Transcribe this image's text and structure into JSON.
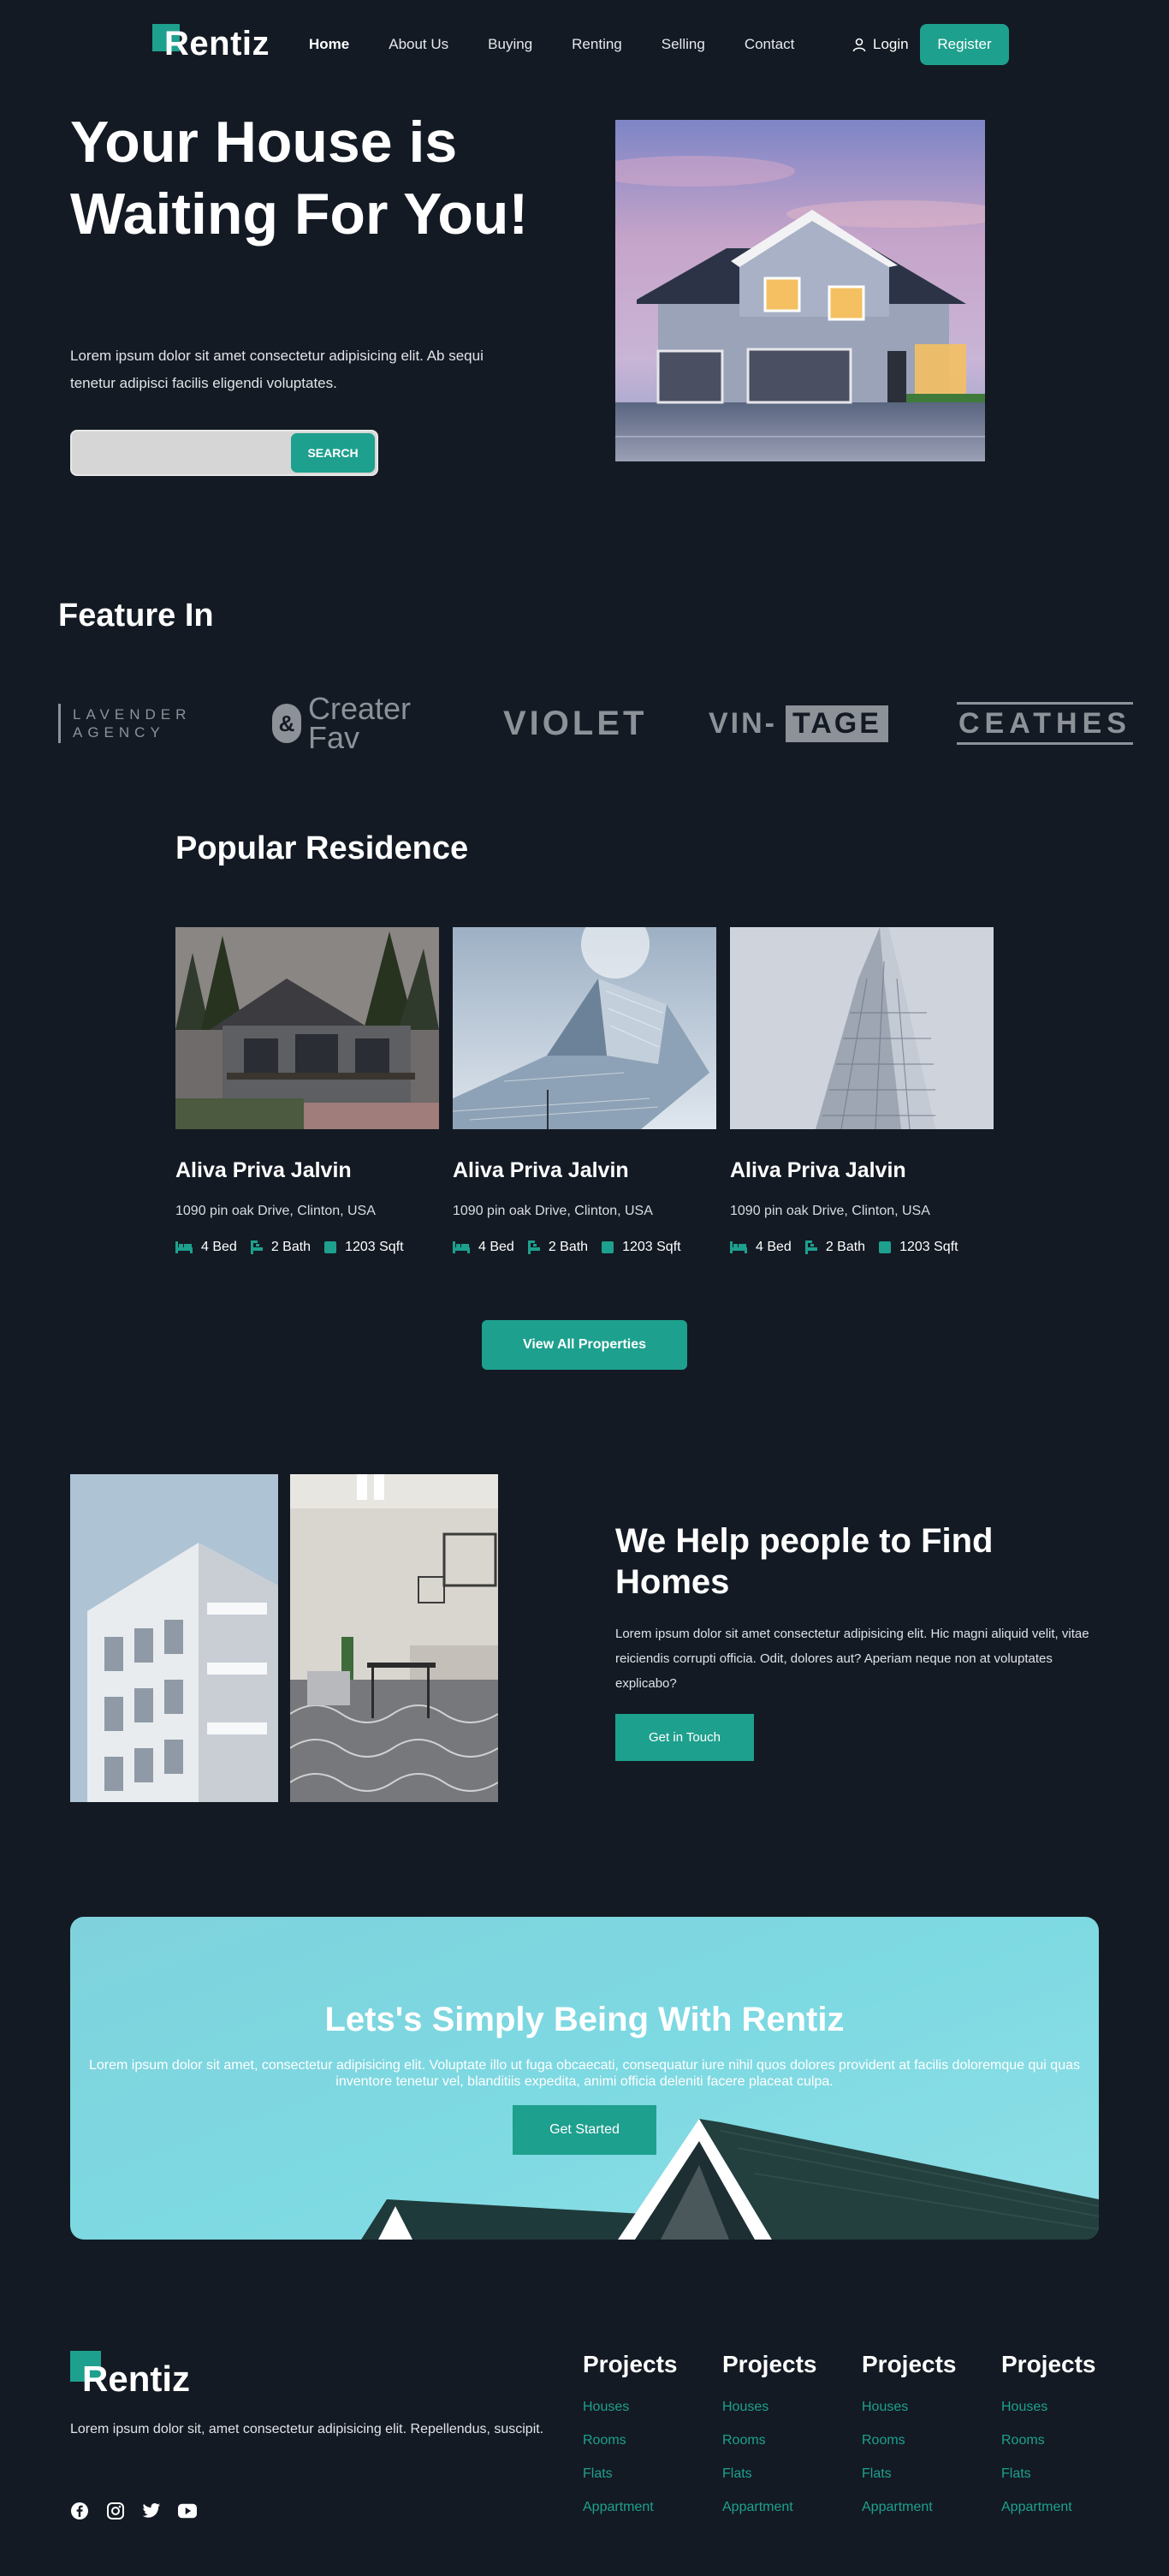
{
  "brand": {
    "name": "Rentiz",
    "accent": "#1ea08e",
    "background": "#131a23"
  },
  "nav": {
    "links": [
      {
        "label": "Home",
        "active": true
      },
      {
        "label": "About Us"
      },
      {
        "label": "Buying"
      },
      {
        "label": "Renting"
      },
      {
        "label": "Selling"
      },
      {
        "label": "Contact"
      }
    ],
    "login_label": "Login",
    "login_icon": "user-icon",
    "register_label": "Register"
  },
  "hero": {
    "title": "Your House is Waiting For You!",
    "description": "Lorem ipsum dolor sit amet consectetur adipisicing elit. Ab sequi tenetur adipisci facilis eligendi voluptates.",
    "search_placeholder": "",
    "search_value": "",
    "search_button": "SEARCH"
  },
  "feature": {
    "title": "Feature In",
    "brands": [
      {
        "lines": [
          "LAVENDER",
          "AGENCY"
        ]
      },
      {
        "mark": "&",
        "lines": [
          "Creater",
          "Fav"
        ]
      },
      {
        "text": "VIOLET"
      },
      {
        "text": "VIN-",
        "boxed": "TAGE"
      },
      {
        "text": "CEATHES"
      }
    ]
  },
  "popular": {
    "title": "Popular Residence",
    "cards": [
      {
        "title": "Aliva Priva Jalvin",
        "address": "1090 pin oak Drive, Clinton, USA",
        "bed": "4 Bed",
        "bath": "2 Bath",
        "area": "1203 Sqft"
      },
      {
        "title": "Aliva Priva Jalvin",
        "address": "1090 pin oak Drive, Clinton, USA",
        "bed": "4 Bed",
        "bath": "2 Bath",
        "area": "1203 Sqft"
      },
      {
        "title": "Aliva Priva Jalvin",
        "address": "1090 pin oak Drive, Clinton, USA",
        "bed": "4 Bed",
        "bath": "2 Bath",
        "area": "1203 Sqft"
      }
    ],
    "view_all": "View All Properties"
  },
  "help": {
    "title": "We Help people to Find Homes",
    "description": "Lorem ipsum dolor sit amet consectetur adipisicing elit. Hic magni aliquid velit, vitae reiciendis corrupti officia. Odit, dolores aut? Aperiam neque non at voluptates explicabo?",
    "button": "Get in Touch"
  },
  "cta": {
    "title": "Lets's Simply Being With Rentiz",
    "description": "Lorem ipsum dolor sit amet, consectetur adipisicing elit. Voluptate illo ut fuga obcaecati, consequatur iure nihil quos dolores provident at facilis doloremque qui quas inventore tenetur vel, blanditiis expedita, animi officia deleniti facere placeat culpa.",
    "button": "Get Started"
  },
  "footer": {
    "description": "Lorem ipsum dolor sit, amet consectetur adipisicing elit. Repellendus, suscipit.",
    "socials": [
      "facebook-icon",
      "instagram-icon",
      "twitter-icon",
      "youtube-icon"
    ],
    "columns": [
      {
        "title": "Projects",
        "links": [
          "Houses",
          "Rooms",
          "Flats",
          "Appartment"
        ]
      },
      {
        "title": "Projects",
        "links": [
          "Houses",
          "Rooms",
          "Flats",
          "Appartment"
        ]
      },
      {
        "title": "Projects",
        "links": [
          "Houses",
          "Rooms",
          "Flats",
          "Appartment"
        ]
      },
      {
        "title": "Projects",
        "links": [
          "Houses",
          "Rooms",
          "Flats",
          "Appartment"
        ]
      }
    ]
  }
}
